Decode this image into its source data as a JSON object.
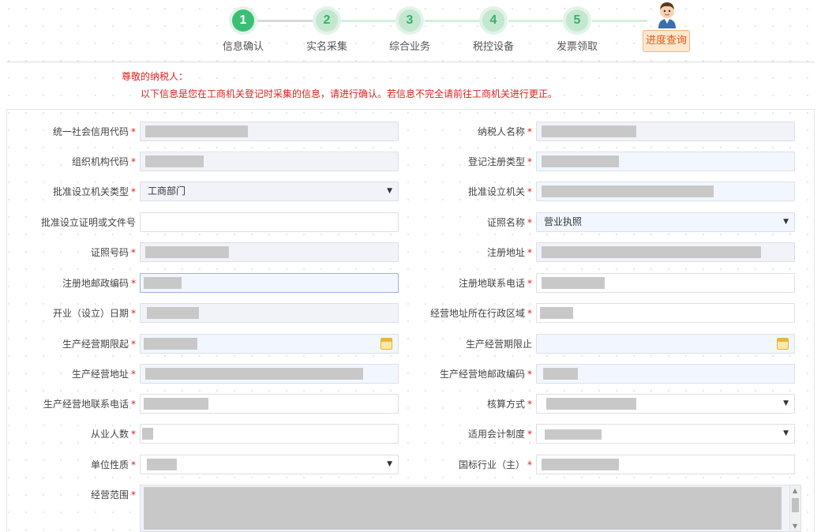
{
  "stepper": {
    "steps": [
      {
        "num": "1",
        "label": "信息确认"
      },
      {
        "num": "2",
        "label": "实名采集"
      },
      {
        "num": "3",
        "label": "综合业务"
      },
      {
        "num": "4",
        "label": "税控设备"
      },
      {
        "num": "5",
        "label": "发票领取"
      }
    ],
    "progress_button": "进度查询"
  },
  "notice": {
    "greeting": "尊敬的纳税人：",
    "message": "以下信息是您在工商机关登记时采集的信息，请进行确认。若信息不完全请前往工商机关进行更正。"
  },
  "required_mark": "*",
  "form": {
    "unified_credit_code": {
      "label": "统一社会信用代码"
    },
    "taxpayer_name": {
      "label": "纳税人名称"
    },
    "org_code": {
      "label": "组织机构代码"
    },
    "registration_type": {
      "label": "登记注册类型"
    },
    "approval_authority_type": {
      "label": "批准设立机关类型",
      "value": "工商部门"
    },
    "approval_authority": {
      "label": "批准设立机关"
    },
    "approval_doc_no": {
      "label": "批准设立证明或文件号"
    },
    "certificate_name": {
      "label": "证照名称",
      "value": "营业执照"
    },
    "certificate_no": {
      "label": "证照号码"
    },
    "registered_address": {
      "label": "注册地址"
    },
    "registered_postcode": {
      "label": "注册地邮政编码"
    },
    "registered_phone": {
      "label": "注册地联系电话"
    },
    "opening_date": {
      "label": "开业（设立）日期"
    },
    "business_region": {
      "label": "经营地址所在行政区域"
    },
    "period_start": {
      "label": "生产经营期限起"
    },
    "period_end": {
      "label": "生产经营期限止"
    },
    "business_address": {
      "label": "生产经营地址"
    },
    "business_postcode": {
      "label": "生产经营地邮政编码"
    },
    "business_phone": {
      "label": "生产经营地联系电话"
    },
    "accounting_method": {
      "label": "核算方式"
    },
    "employees": {
      "label": "从业人数"
    },
    "accounting_system": {
      "label": "适用会计制度"
    },
    "entity_nature": {
      "label": "单位性质"
    },
    "industry": {
      "label": "国标行业（主）"
    },
    "business_scope": {
      "label": "经营范围"
    }
  }
}
